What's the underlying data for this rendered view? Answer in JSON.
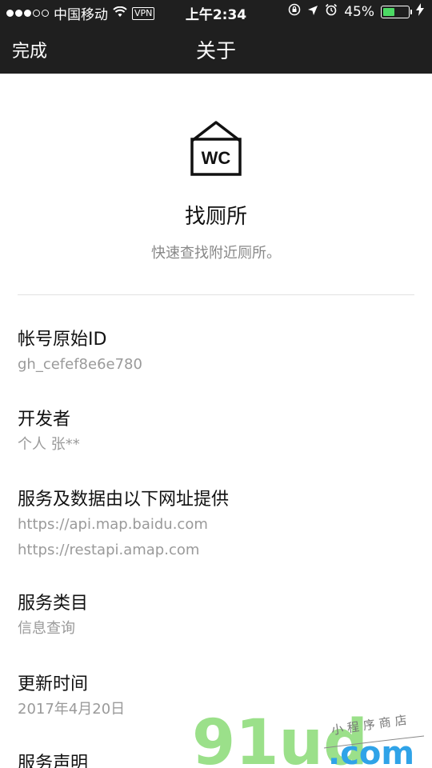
{
  "status_bar": {
    "carrier": "中国移动",
    "vpn": "VPN",
    "time": "上午2:34",
    "battery": "45%",
    "battery_level": 0.45,
    "battery_color": "#4cd964"
  },
  "nav": {
    "done_label": "完成",
    "title": "关于"
  },
  "app": {
    "icon_text": "WC",
    "icon": "toilet-sign-icon",
    "name": "找厕所",
    "description": "快速查找附近厕所。"
  },
  "sections": {
    "account_id": {
      "title": "帐号原始ID",
      "value": "gh_cefef8e6e780"
    },
    "developer": {
      "title": "开发者",
      "value": "个人 张**"
    },
    "service_urls": {
      "title": "服务及数据由以下网址提供",
      "values": [
        "https://api.map.baidu.com",
        "https://restapi.amap.com"
      ]
    },
    "category": {
      "title": "服务类目",
      "value": "信息查询"
    },
    "updated": {
      "title": "更新时间",
      "value": "2017年4月20日"
    },
    "statement": {
      "title": "服务声明"
    }
  },
  "watermark": {
    "text_big": "91ud",
    "text_com": ".com",
    "text_small": "小程序商店",
    "color_green": "#9be08a",
    "color_blue": "#2fa3e8"
  }
}
